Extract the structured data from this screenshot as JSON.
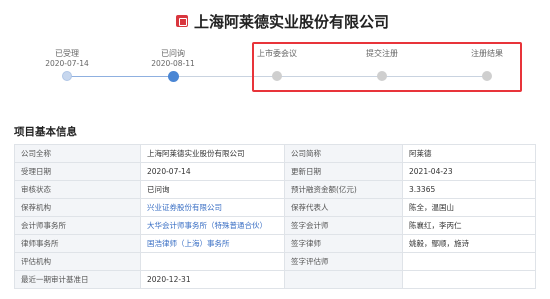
{
  "header": {
    "title": "上海阿莱德实业股份有限公司",
    "logo_icon": "company-logo-icon"
  },
  "timeline": {
    "steps": [
      {
        "label": "已受理",
        "date": "2020-07-14",
        "state": "done"
      },
      {
        "label": "已问询",
        "date": "2020-08-11",
        "state": "current"
      },
      {
        "label": "上市委会议",
        "date": "",
        "state": "pending"
      },
      {
        "label": "提交注册",
        "date": "",
        "state": "pending"
      },
      {
        "label": "注册结果",
        "date": "",
        "state": "pending"
      }
    ],
    "colors": {
      "done": "#8fb0e0",
      "current": "#4a86d4",
      "pending": "#cfcfcf",
      "highlight_box": "#e8343a"
    }
  },
  "section": {
    "title": "项目基本信息"
  },
  "info": {
    "rows": [
      {
        "k1": "公司全称",
        "v1": "上海阿莱德实业股份有限公司",
        "k2": "公司简称",
        "v2": "阿莱德"
      },
      {
        "k1": "受理日期",
        "v1": "2020-07-14",
        "k2": "更新日期",
        "v2": "2021-04-23"
      },
      {
        "k1": "审核状态",
        "v1": "已问询",
        "k2": "预计融资金额(亿元)",
        "v2": "3.3365"
      },
      {
        "k1": "保荐机构",
        "v1": "兴业证券股份有限公司",
        "k2": "保荐代表人",
        "v2": "陈全，温国山"
      },
      {
        "k1": "会计师事务所",
        "v1": "大华会计师事务所（特殊普通合伙）",
        "k2": "签字会计师",
        "v2": "陈襄红，李丙仁"
      },
      {
        "k1": "律师事务所",
        "v1": "国浩律师（上海）事务所",
        "k2": "签字律师",
        "v2": "姚毅，鄢顺，施诗"
      },
      {
        "k1": "评估机构",
        "v1": "",
        "k2": "签字评估师",
        "v2": ""
      },
      {
        "k1": "最近一期审计基准日",
        "v1": "2020-12-31",
        "k2": "",
        "v2": ""
      }
    ],
    "link_color": "#3a6fc4"
  }
}
